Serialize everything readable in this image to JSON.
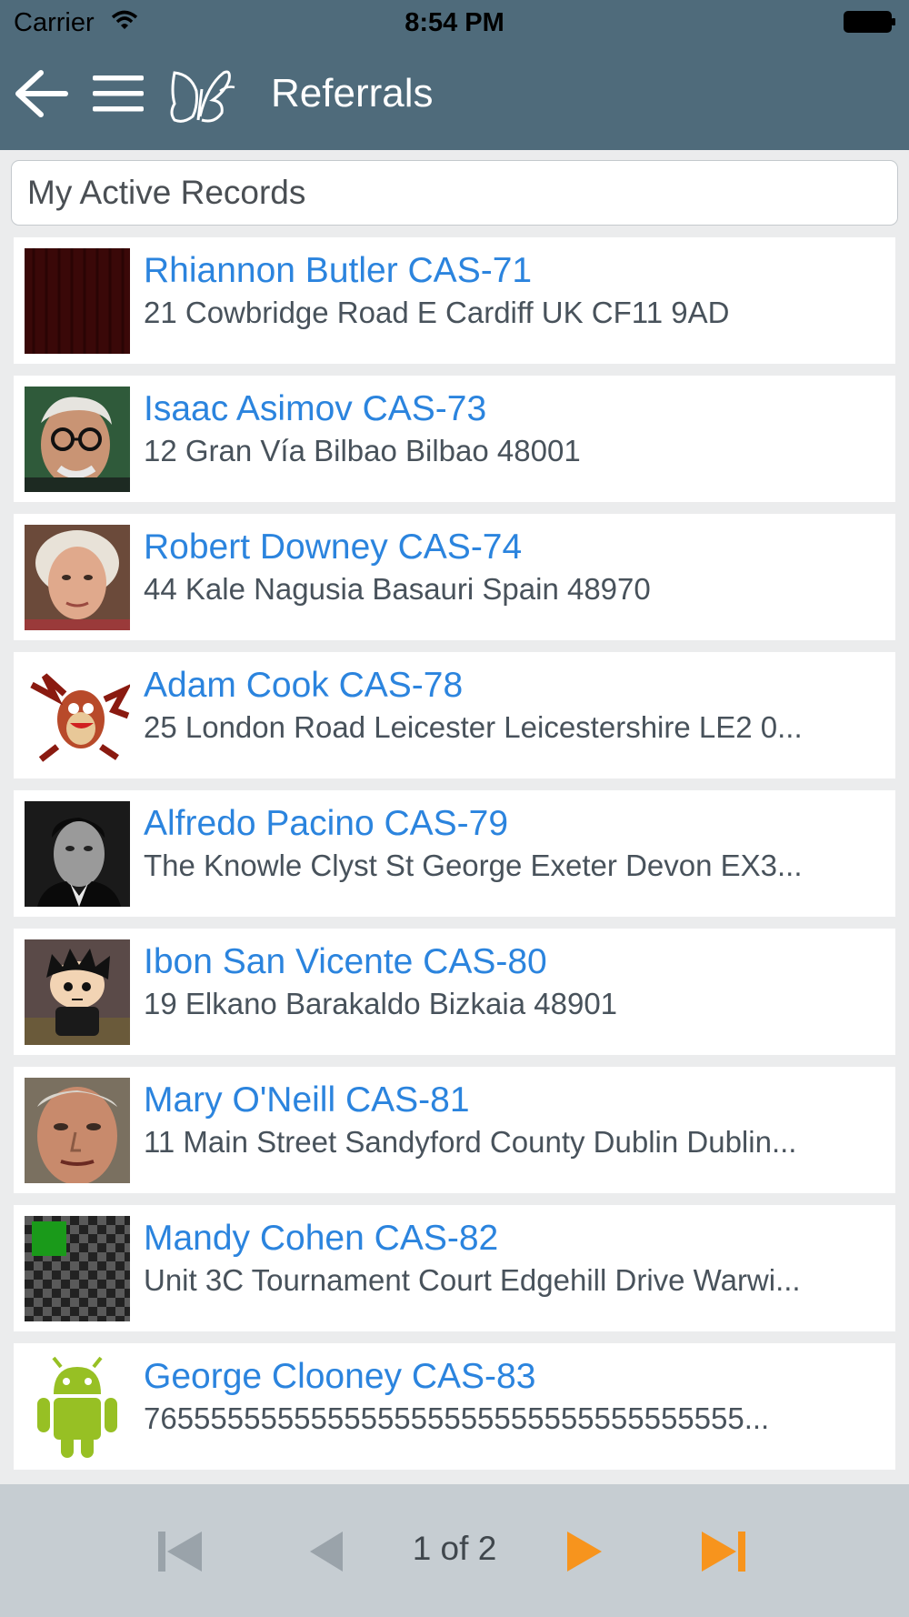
{
  "status_bar": {
    "carrier": "Carrier",
    "time": "8:54 PM"
  },
  "nav": {
    "title": "Referrals"
  },
  "filter": {
    "label": "My Active Records"
  },
  "records": [
    {
      "name": "Rhiannon Butler CAS-71",
      "address": "21 Cowbridge Road E Cardiff UK CF11 9AD",
      "avatar": "dark-red-curtain"
    },
    {
      "name": "Isaac Asimov CAS-73",
      "address": "12 Gran Vía Bilbao Bilbao 48001",
      "avatar": "man-with-glasses-photo"
    },
    {
      "name": "Robert Downey CAS-74",
      "address": "44 Kale Nagusia Basauri Spain 48970",
      "avatar": "elderly-woman-photo"
    },
    {
      "name": "Adam Cook CAS-78",
      "address": "25 London Road Leicester Leicestershire LE2 0...",
      "avatar": "cartoon-devil"
    },
    {
      "name": "Alfredo Pacino CAS-79",
      "address": "The Knowle Clyst St George Exeter Devon EX3...",
      "avatar": "black-and-white-portrait"
    },
    {
      "name": "Ibon San Vicente CAS-80",
      "address": "19 Elkano Barakaldo Bizkaia 48901",
      "avatar": "cartoon-kid"
    },
    {
      "name": "Mary O'Neill CAS-81",
      "address": "11 Main Street Sandyford County Dublin Dublin...",
      "avatar": "man-face-photo"
    },
    {
      "name": "Mandy Cohen CAS-82",
      "address": "Unit 3C Tournament Court Edgehill Drive Warwi...",
      "avatar": "checkerboard"
    },
    {
      "name": "George Clooney CAS-83",
      "address": "765555555555555555555555555555555555...",
      "avatar": "android-robot"
    }
  ],
  "pager": {
    "label": "1 of 2",
    "active_color": "#f7941d",
    "disabled_color": "#9aa3aa"
  },
  "colors": {
    "nav_bg": "#4f6b7b",
    "link": "#2b84de",
    "pager_bg": "#c6cdd2"
  }
}
